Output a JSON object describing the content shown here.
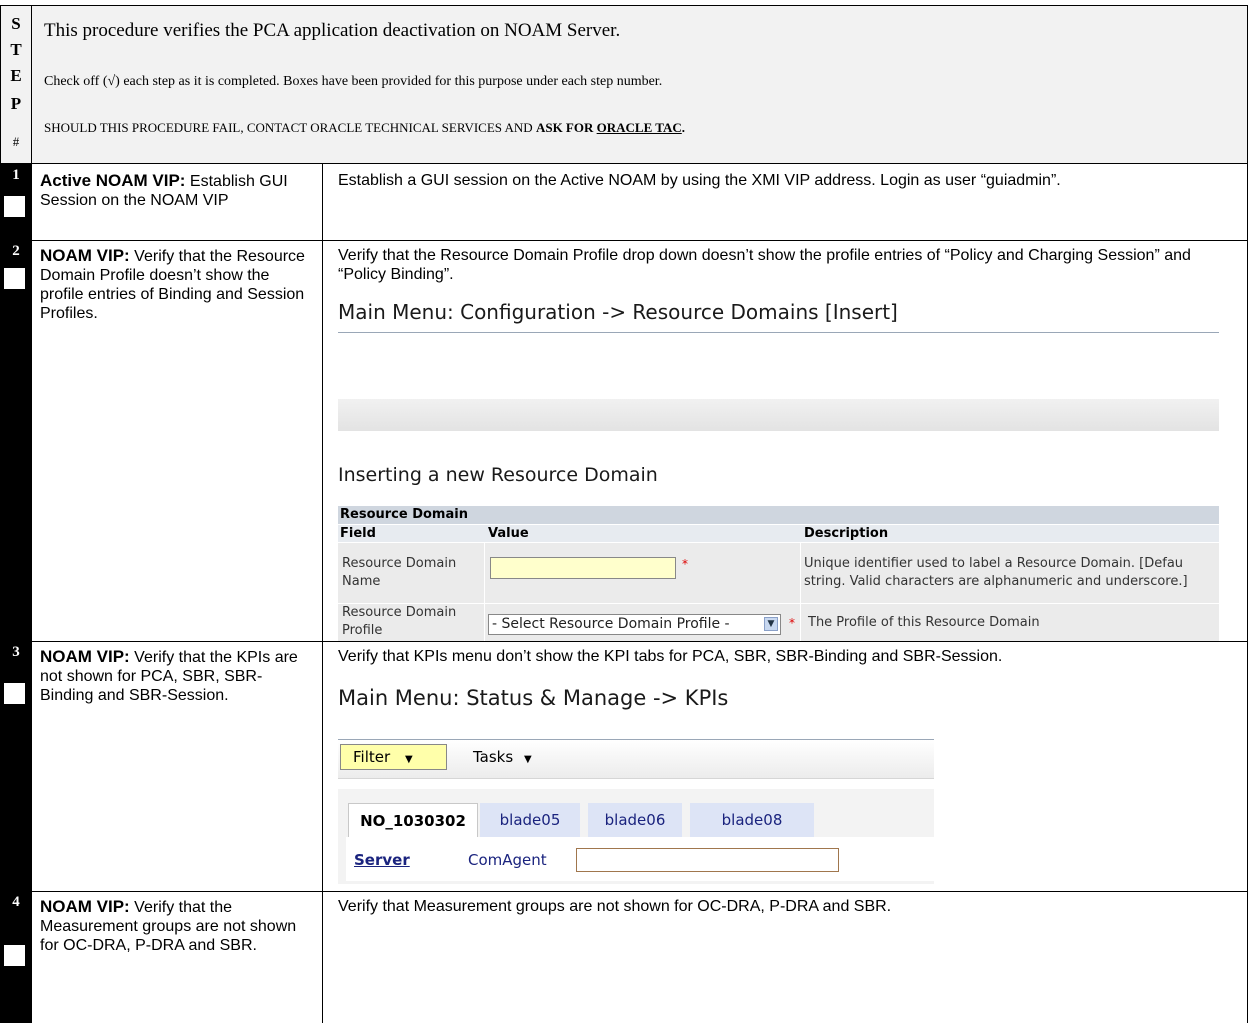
{
  "header": {
    "step_letters": [
      "S",
      "T",
      "E",
      "P",
      "#"
    ],
    "intro": "This procedure verifies the PCA application deactivation on NOAM Server.",
    "checkoff": "Check off (√) each step as it is completed. Boxes have been provided for this purpose under each step number.",
    "contact_prefix": "SHOULD THIS PROCEDURE FAIL, CONTACT ORACLE TECHNICAL SERVICES AND ",
    "contact_bold": "ASK FOR ",
    "contact_link": "ORACLE TAC",
    "contact_end": "."
  },
  "steps": [
    {
      "number": "1",
      "label_bold": "Active NOAM VIP:",
      "label_rest": " Establish GUI Session on the NOAM VIP",
      "desc": "Establish a GUI session on the Active NOAM by using the XMI VIP address. Login as user “guiadmin”."
    },
    {
      "number": "2",
      "label_bold": "NOAM VIP:",
      "label_rest": " Verify that the Resource Domain Profile doesn’t show the profile entries of Binding and Session Profiles.",
      "desc": "Verify that the Resource Domain Profile  drop down doesn’t show the profile entries of “Policy and Charging Session” and “Policy Binding”."
    },
    {
      "number": "3",
      "label_bold": "NOAM VIP:",
      "label_rest": " Verify that the KPIs are not shown for PCA, SBR, SBR-Binding and SBR-Session.",
      "desc": "Verify that KPIs menu don’t show the KPI tabs for PCA, SBR, SBR-Binding and SBR-Session."
    },
    {
      "number": "4",
      "label_bold": "NOAM VIP:",
      "label_rest": " Verify that the Measurement groups are not shown for OC-DRA, P-DRA and SBR.",
      "desc": "Verify that Measurement groups are not shown for OC-DRA, P-DRA and SBR."
    }
  ],
  "screenshot_resource_domain": {
    "title": "Main Menu: Configuration -> Resource Domains [Insert]",
    "subtitle": "Inserting a new Resource Domain",
    "table_caption": "Resource Domain",
    "columns": [
      "Field",
      "Value",
      "Description"
    ],
    "rows": [
      {
        "field_line1": "Resource Domain",
        "field_line2": "Name",
        "desc_line1": "Unique identifier used to label a Resource Domain. [Defau",
        "desc_line2": "string. Valid characters are alphanumeric and underscore.]"
      },
      {
        "field_line1": "Resource Domain",
        "field_line2": "Profile",
        "select_value": "- Select Resource Domain Profile -",
        "desc_line1": "The Profile of this Resource Domain"
      }
    ],
    "required_mark": "*"
  },
  "screenshot_kpis": {
    "title": "Main Menu: Status & Manage -> KPIs",
    "filter_label": "Filter",
    "tasks_label": "Tasks",
    "tabs": [
      "NO_1030302",
      "blade05",
      "blade06",
      "blade08"
    ],
    "subtabs": [
      "Server",
      "ComAgent"
    ]
  }
}
